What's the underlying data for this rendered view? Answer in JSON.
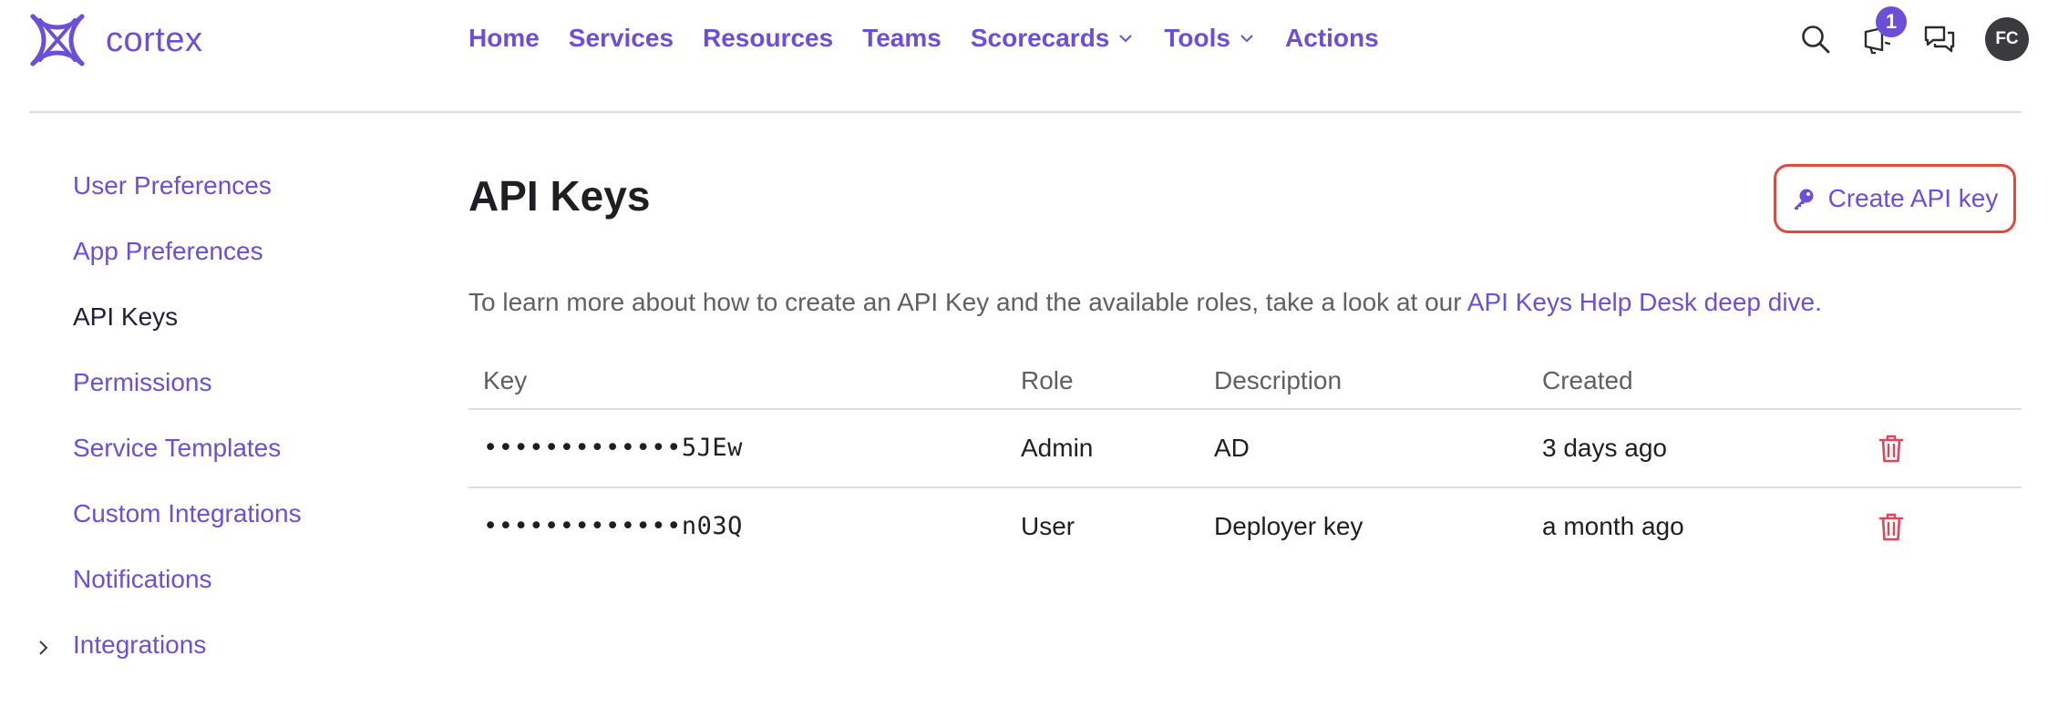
{
  "brand": {
    "name": "cortex"
  },
  "nav": {
    "home": "Home",
    "services": "Services",
    "resources": "Resources",
    "teams": "Teams",
    "scorecards": "Scorecards",
    "tools": "Tools",
    "actions": "Actions"
  },
  "header": {
    "notifications_count": "1",
    "avatar_initials": "FC"
  },
  "sidebar": {
    "items": [
      {
        "label": "User Preferences"
      },
      {
        "label": "App Preferences"
      },
      {
        "label": "API Keys"
      },
      {
        "label": "Permissions"
      },
      {
        "label": "Service Templates"
      },
      {
        "label": "Custom Integrations"
      },
      {
        "label": "Notifications"
      },
      {
        "label": "Integrations"
      }
    ]
  },
  "main": {
    "title": "API Keys",
    "create_label": "Create API key",
    "help_text": "To learn more about how to create an API Key and the available roles, take a look at our ",
    "help_link": "API Keys Help Desk deep dive."
  },
  "table": {
    "headers": {
      "key": "Key",
      "role": "Role",
      "description": "Description",
      "created": "Created"
    },
    "rows": [
      {
        "key": "•••••••••••••5JEw",
        "role": "Admin",
        "description": "AD",
        "created": "3 days ago"
      },
      {
        "key": "•••••••••••••n03Q",
        "role": "User",
        "description": "Deployer key",
        "created": "a month ago"
      }
    ]
  },
  "colors": {
    "accent": "#6b4fd8",
    "danger": "#e04a3a",
    "trash": "#e0455b"
  }
}
